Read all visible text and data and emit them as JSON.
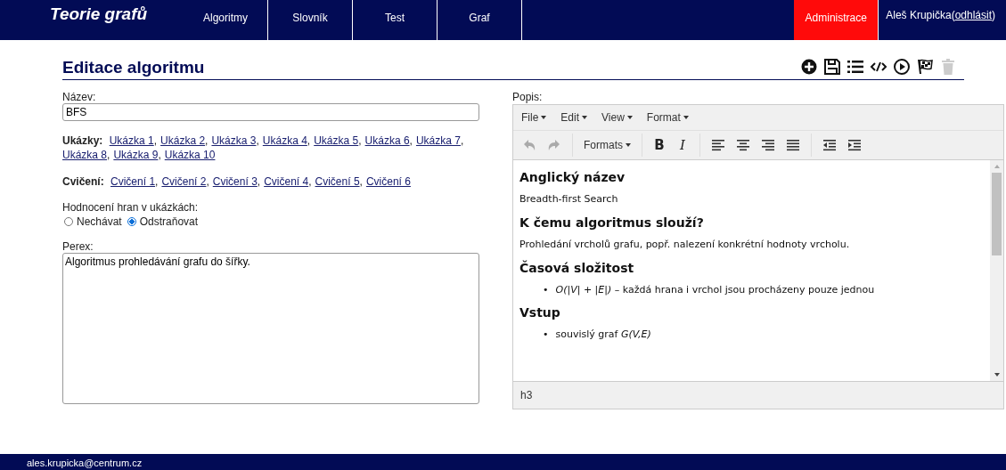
{
  "nav": {
    "logo": "Teorie grafů",
    "items": [
      {
        "label": "Algoritmy",
        "selected": false
      },
      {
        "label": "Slovník",
        "selected": false
      },
      {
        "label": "Test",
        "selected": false
      },
      {
        "label": "Graf",
        "selected": false
      }
    ],
    "admin": {
      "label": "Administrace",
      "selected": true
    },
    "user": {
      "name": "Aleš Krupička",
      "open": "(",
      "link": "odhlásit",
      "close": ")"
    }
  },
  "page_title": "Editace algoritmu",
  "toolbar": [
    {
      "kind": "add",
      "disabled": false
    },
    {
      "kind": "save",
      "disabled": false
    },
    {
      "kind": "list",
      "disabled": false
    },
    {
      "kind": "code",
      "disabled": false
    },
    {
      "kind": "play",
      "disabled": false
    },
    {
      "kind": "flag",
      "disabled": false
    },
    {
      "kind": "trash",
      "disabled": true
    }
  ],
  "name_field": {
    "label": "Název:",
    "value": "BFS"
  },
  "examples": {
    "label": "Ukázky:",
    "separator": ",",
    "links": [
      "Ukázka 1",
      "Ukázka 2",
      "Ukázka 3",
      "Ukázka 4",
      "Ukázka 5",
      "Ukázka 6",
      "Ukázka 7",
      "Ukázka 8",
      "Ukázka 9",
      "Ukázka 10"
    ]
  },
  "exercises": {
    "label": "Cvičení:",
    "separator": ",",
    "links": [
      "Cvičení 1",
      "Cvičení 2",
      "Cvičení 3",
      "Cvičení 4",
      "Cvičení 5",
      "Cvičení 6"
    ]
  },
  "edge_eval": {
    "label": "Hodnocení hran v ukázkách:",
    "options": [
      {
        "label": "Nechávat",
        "selected": false
      },
      {
        "label": "Odstraňovat",
        "selected": true
      }
    ]
  },
  "perex": {
    "label": "Perex:",
    "value": "Algoritmus prohledávání grafu do šířky."
  },
  "editor": {
    "label": "Popis:",
    "menus": [
      "File",
      "Edit",
      "View",
      "Format"
    ],
    "tools": [
      {
        "kind": "undo",
        "disabled": true
      },
      {
        "kind": "redo",
        "disabled": true
      },
      {
        "kind": "sep"
      },
      {
        "kind": "formats",
        "label": "Formats"
      },
      {
        "kind": "sep"
      },
      {
        "kind": "bold",
        "label": "B"
      },
      {
        "kind": "italic",
        "label": "I"
      },
      {
        "kind": "sep"
      },
      {
        "kind": "align-left"
      },
      {
        "kind": "align-center"
      },
      {
        "kind": "align-right"
      },
      {
        "kind": "align-justify"
      },
      {
        "kind": "sep"
      },
      {
        "kind": "outdent"
      },
      {
        "kind": "indent"
      }
    ],
    "content": [
      {
        "kind": "h3",
        "text": "Anglický název"
      },
      {
        "kind": "p",
        "text": "Breadth-first Search"
      },
      {
        "kind": "h3",
        "text": "K čemu algoritmus slouží?"
      },
      {
        "kind": "p",
        "text": "Prohledání vrcholů grafu, popř. nalezení konkrétní hodnoty vrcholu."
      },
      {
        "kind": "h3",
        "text": "Časová složitost"
      },
      {
        "kind": "li",
        "marker": "•",
        "text": "*O(|V| + |E|)* – každá hrana i vrchol jsou procházeny pouze jednou"
      },
      {
        "kind": "h3",
        "text": "Vstup"
      },
      {
        "kind": "li",
        "marker": "•",
        "text": "souvislý graf *G(V,E)*"
      }
    ],
    "status": "h3"
  },
  "footer": {
    "email": "ales.krupicka@centrum.cz"
  }
}
